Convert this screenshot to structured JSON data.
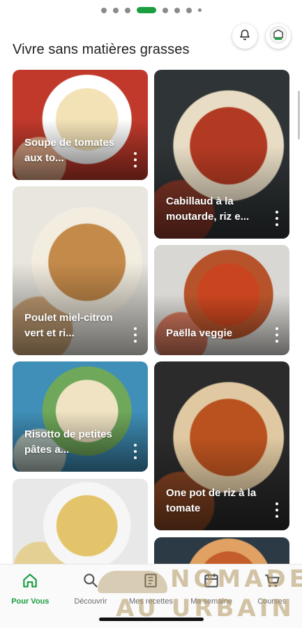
{
  "pager": {
    "dot_count": 8,
    "active_index": 3
  },
  "header": {
    "title": "Vivre sans matières grasses",
    "notifications_icon": "bell-icon",
    "profile_icon": "chef-hat-icon"
  },
  "recipes": [
    {
      "title": "Soupe de tomates aux to...",
      "colors": [
        "#c0392b",
        "#f4e2b7",
        "#ffffff"
      ]
    },
    {
      "title": "Cabillaud à la moutarde, riz e...",
      "colors": [
        "#2f3436",
        "#b33a22",
        "#e8dcc4"
      ]
    },
    {
      "title": "Poulet miel-citron vert et ri...",
      "colors": [
        "#e9e6df",
        "#c48a4a",
        "#f3ede0"
      ]
    },
    {
      "title": "Paëlla veggie",
      "colors": [
        "#d9d7d3",
        "#c9451f",
        "#b6532b"
      ]
    },
    {
      "title": "Risotto de petites pâtes a...",
      "colors": [
        "#3f8fb8",
        "#f0e3c4",
        "#6fa85a"
      ]
    },
    {
      "title": "One pot de riz à la tomate",
      "colors": [
        "#2b2b2b",
        "#b9521f",
        "#e0c9a2"
      ]
    },
    {
      "title": "",
      "colors": [
        "#e8e8e8",
        "#e3c46a",
        "#f6f6f6"
      ]
    },
    {
      "title": "",
      "colors": [
        "#2c3a46",
        "#c45d2b",
        "#e0a162"
      ]
    }
  ],
  "nav": {
    "items": [
      {
        "label": "Pour Vous",
        "icon": "home-icon",
        "active": true
      },
      {
        "label": "Découvrir",
        "icon": "search-icon",
        "active": false
      },
      {
        "label": "Mes recettes",
        "icon": "book-icon",
        "active": false
      },
      {
        "label": "Ma semaine",
        "icon": "calendar-icon",
        "active": false
      },
      {
        "label": "Courses",
        "icon": "cart-icon",
        "active": false
      }
    ]
  },
  "watermark": {
    "line1": "NOMADE",
    "line2": "AU URBAIN"
  },
  "theme": {
    "accent": "#1a9e3f"
  }
}
